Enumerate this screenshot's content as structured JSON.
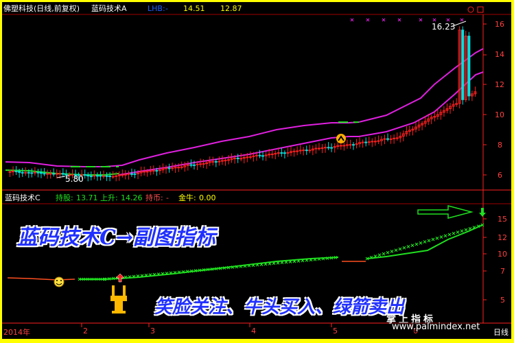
{
  "header": {
    "stock_name": "佛塑科技(日线,前复权)",
    "indicator_name": "蓝码技术A",
    "lhb_label": "LHB:",
    "lhb_value": "-",
    "value1": "14.51",
    "value2": "12.87"
  },
  "sub_header": {
    "indicator_name": "蓝码技术C",
    "hold_label": "持股:",
    "hold_value": "13.71",
    "rise_label": "上升:",
    "rise_value": "14.26",
    "coin_label": "持币:",
    "coin_value": "-",
    "bull_label": "金牛:",
    "bull_value": "0.00"
  },
  "main_chart": {
    "high_annotation": "16.23",
    "low_annotation": "5.80",
    "y_ticks": [
      "16",
      "14",
      "12",
      "10",
      "8",
      "6"
    ]
  },
  "sub_chart": {
    "y_ticks": [
      "15",
      "12",
      "10",
      "7",
      "5"
    ]
  },
  "x_axis": {
    "labels": [
      "2014年",
      "2",
      "3",
      "4",
      "5",
      "6"
    ]
  },
  "overlay": {
    "title": "蓝码技术C→副图指标",
    "caption": "笑脸关注、牛头买入、绿箭卖出"
  },
  "watermark": {
    "text": "掌上指标",
    "url": "www.palmindex.net"
  },
  "corner_label": "日线",
  "colors": {
    "background": "#000000",
    "border": "#ffff00",
    "axis_red": "#ff2020",
    "ma_magenta": "#e020e0",
    "ma_green": "#20e020",
    "candle_up": "#ff2020",
    "candle_down": "#00e0e0",
    "overlay_text": "#2030ff"
  },
  "icons": {
    "window_close": "circle-icon",
    "window_max": "square-icon",
    "smiley": "smiley-icon",
    "bull_head": "bull-head-icon",
    "sell_arrow": "green-arrow-icon"
  }
}
